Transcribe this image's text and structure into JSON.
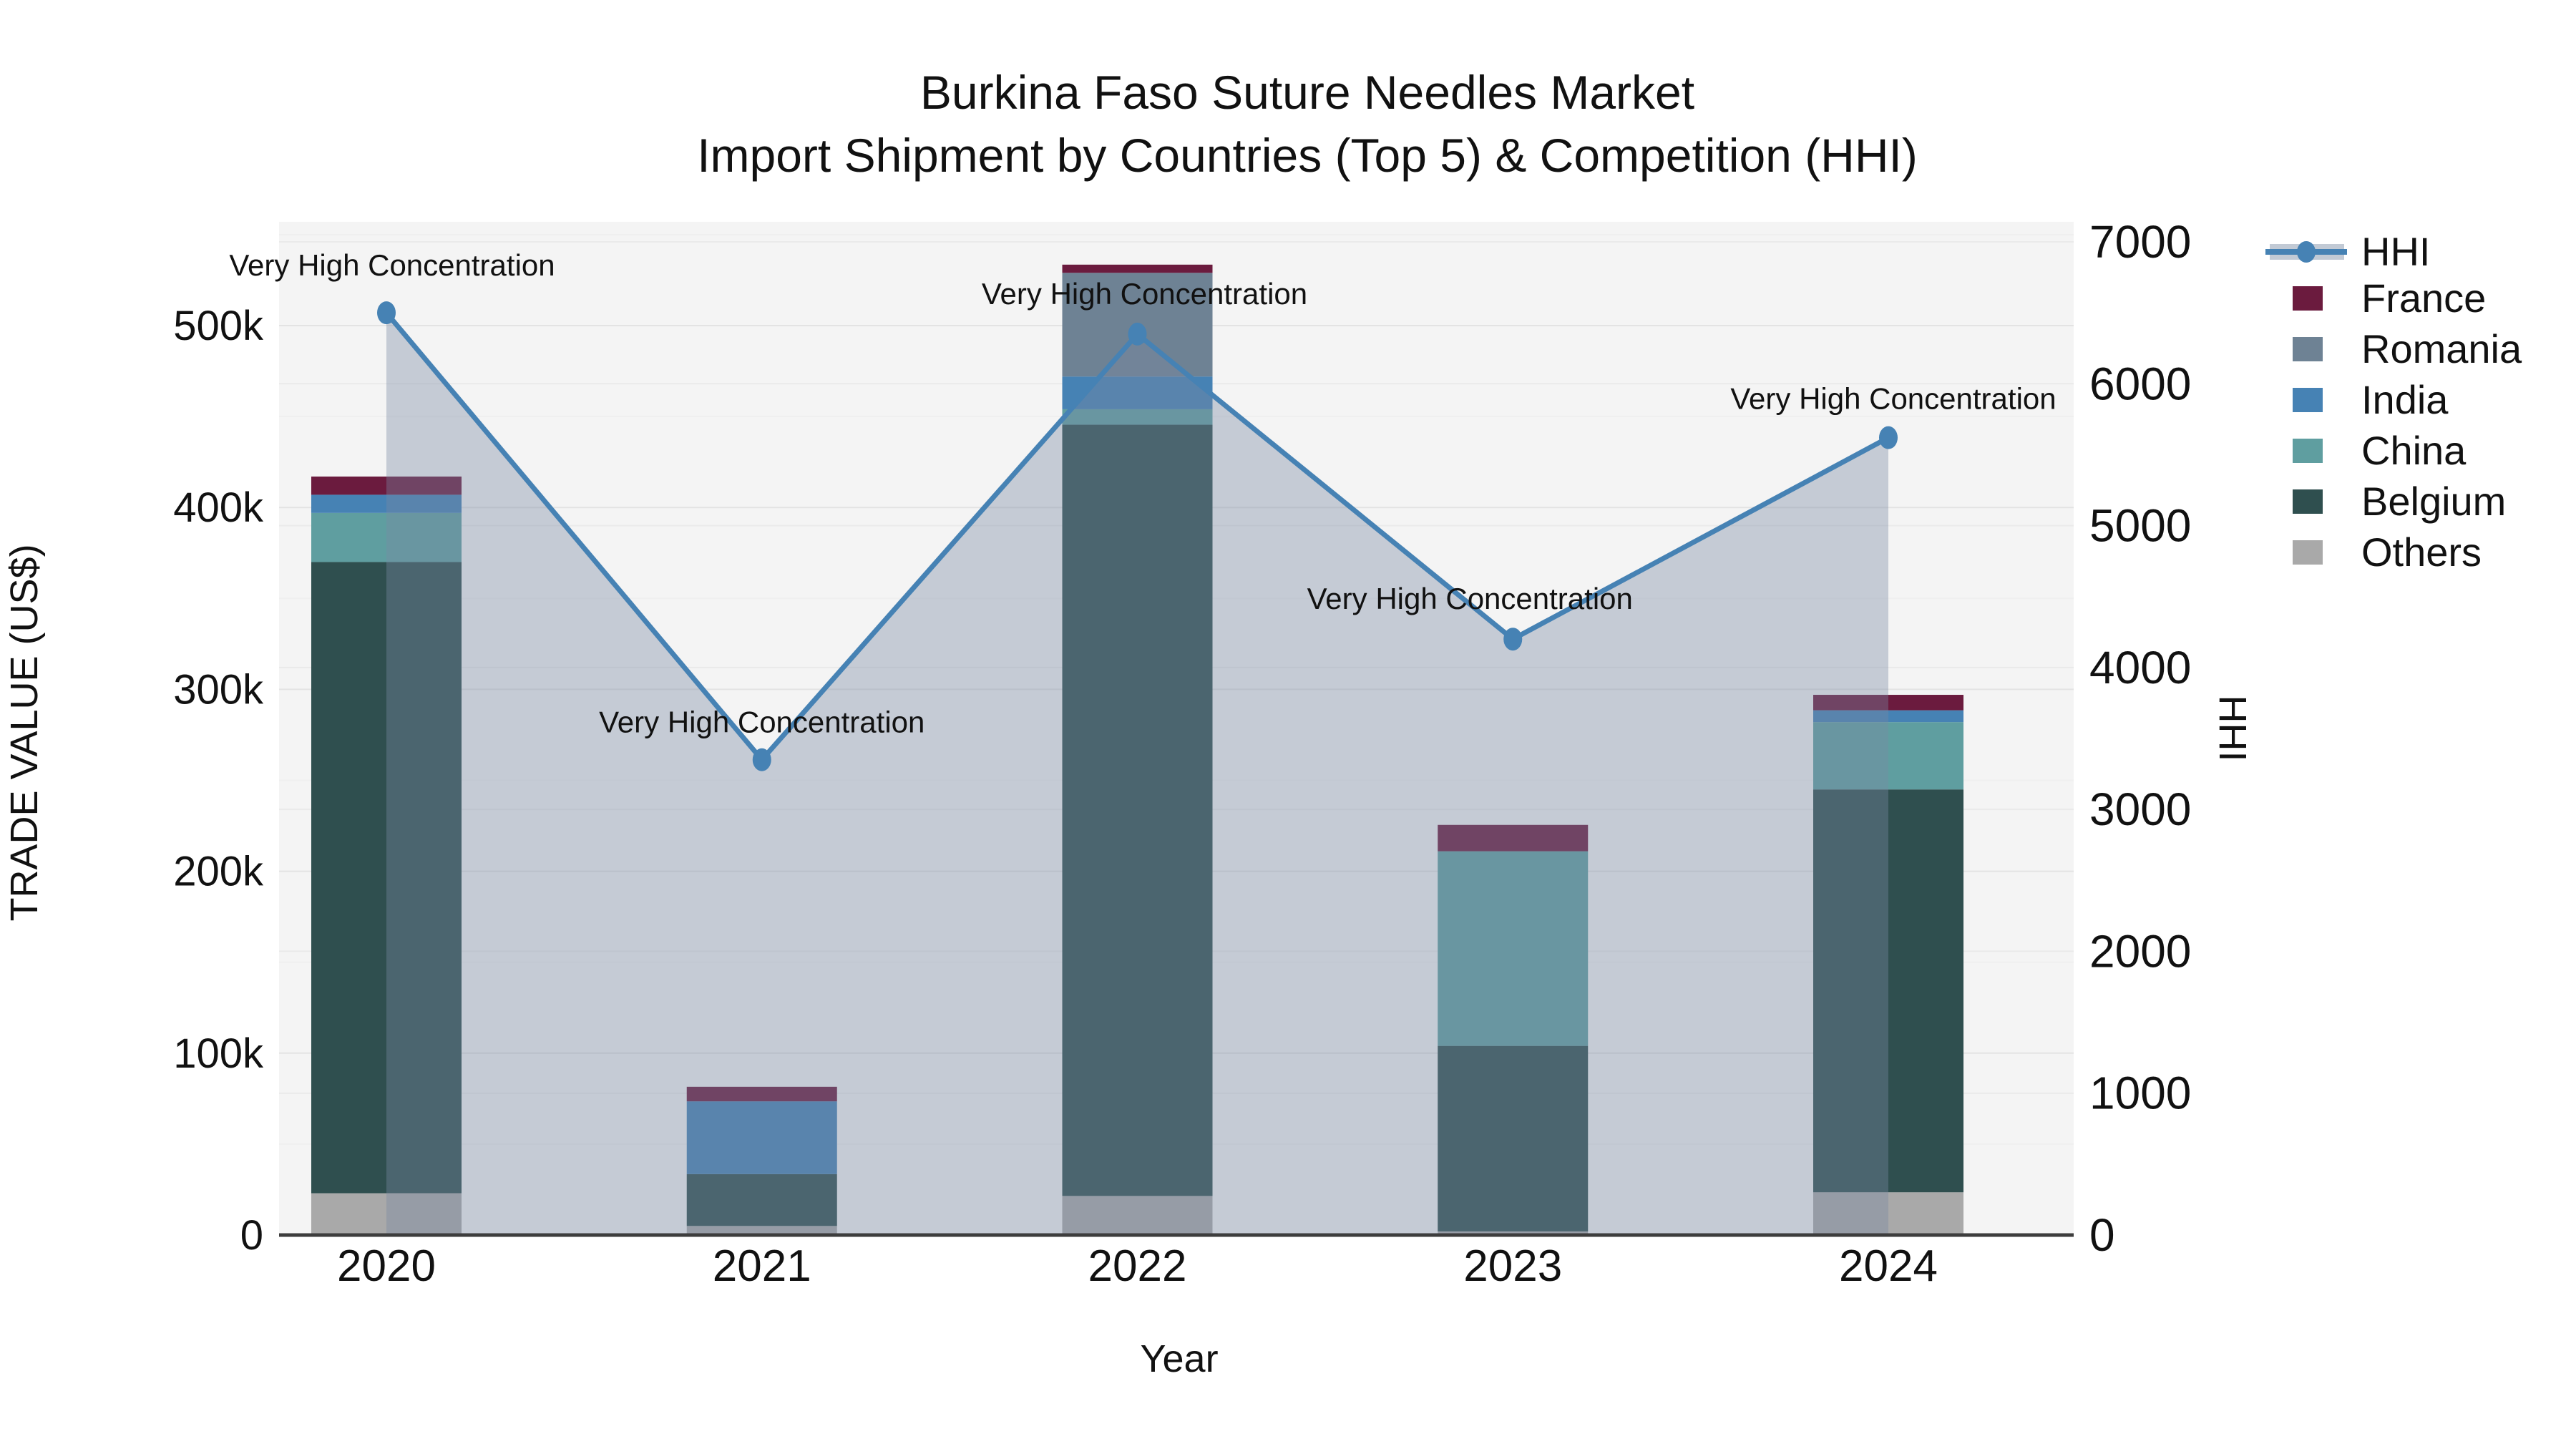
{
  "title": {
    "line1": "Burkina Faso Suture Needles Market",
    "line2": "Import Shipment by Countries (Top 5) & Competition (HHI)"
  },
  "axes": {
    "x_label": "Year",
    "y_left_label": "TRADE VALUE (US$)",
    "y_right_label": "HHI"
  },
  "legend": {
    "items": [
      {
        "label": "HHI",
        "type": "line"
      },
      {
        "label": "France",
        "type": "patch"
      },
      {
        "label": "Romania",
        "type": "patch"
      },
      {
        "label": "India",
        "type": "patch"
      },
      {
        "label": "China",
        "type": "patch"
      },
      {
        "label": "Belgium",
        "type": "patch"
      },
      {
        "label": "Others",
        "type": "patch"
      }
    ]
  },
  "colors": {
    "hhi_line": "#4682B4",
    "hhi_marker": "#4682B4",
    "hhi_area_fill": "rgba(120,137,162,0.38)",
    "plot_background": "#f4f4f4",
    "axis_line": "#3d3d3d",
    "grid_major": "#e3e3e3",
    "grid_minor": "#efefef",
    "grid_right": "#eaeaea"
  },
  "chart_data": {
    "type": "bar",
    "subtype": "stacked-bars-with-line-overlay",
    "title": "Burkina Faso Suture Needles Market",
    "subtitle": "Import Shipment by Countries (Top 5) & Competition (HHI)",
    "xlabel": "Year",
    "ylabel_left": "TRADE VALUE (US$)",
    "ylabel_right": "HHI",
    "categories": [
      "2020",
      "2021",
      "2022",
      "2023",
      "2024"
    ],
    "stack_order_bottom_to_top": [
      "Others",
      "Belgium",
      "China",
      "India",
      "Romania",
      "France"
    ],
    "series": [
      {
        "name": "France",
        "color": "#6B1B3E",
        "values": [
          10000,
          8000,
          4500,
          14500,
          8500
        ]
      },
      {
        "name": "Romania",
        "color": "#6E8294",
        "values": [
          0,
          0,
          57000,
          0,
          0
        ]
      },
      {
        "name": "India",
        "color": "#4682B4",
        "values": [
          10000,
          40000,
          18000,
          0,
          6500
        ]
      },
      {
        "name": "China",
        "color": "#5F9EA0",
        "values": [
          27000,
          0,
          8500,
          107000,
          37000
        ]
      },
      {
        "name": "Belgium",
        "color": "#2F4F4F",
        "values": [
          347000,
          28500,
          424000,
          102000,
          221500
        ]
      },
      {
        "name": "Others",
        "color": "#A9A9A9",
        "values": [
          23000,
          5000,
          21500,
          2000,
          23500
        ]
      }
    ],
    "totals_by_year": [
      417000,
      81500,
      533500,
      225500,
      297000
    ],
    "line_series": {
      "name": "HHI",
      "axis": "right",
      "values": [
        6500,
        3350,
        6350,
        4200,
        5620
      ]
    },
    "annotations": [
      {
        "year": "2020",
        "text": "Very High Concentration"
      },
      {
        "year": "2021",
        "text": "Very High Concentration"
      },
      {
        "year": "2022",
        "text": "Very High Concentration"
      },
      {
        "year": "2023",
        "text": "Very High Concentration"
      },
      {
        "year": "2024",
        "text": "Very High Concentration"
      }
    ],
    "y_left_ticks": [
      {
        "value": 0,
        "label": "0"
      },
      {
        "value": 100000,
        "label": "100k"
      },
      {
        "value": 200000,
        "label": "200k"
      },
      {
        "value": 300000,
        "label": "300k"
      },
      {
        "value": 400000,
        "label": "400k"
      },
      {
        "value": 500000,
        "label": "500k"
      }
    ],
    "y_right_ticks": [
      {
        "value": 0,
        "label": "0"
      },
      {
        "value": 1000,
        "label": "1000"
      },
      {
        "value": 2000,
        "label": "2000"
      },
      {
        "value": 3000,
        "label": "3000"
      },
      {
        "value": 4000,
        "label": "4000"
      },
      {
        "value": 5000,
        "label": "5000"
      },
      {
        "value": 6000,
        "label": "6000"
      },
      {
        "value": 7000,
        "label": "7000"
      }
    ],
    "ylim_left": [
      0,
      557000
    ],
    "ylim_right": [
      0,
      7140
    ],
    "grid": true,
    "legend_position": "right"
  }
}
